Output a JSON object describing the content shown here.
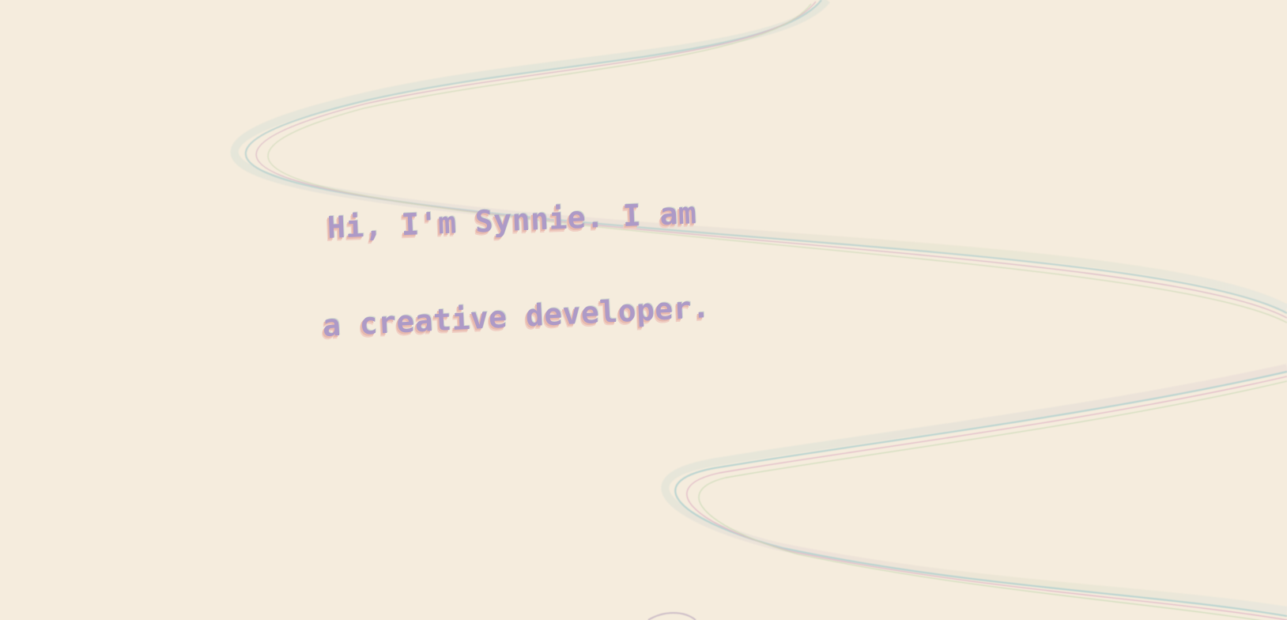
{
  "hero": {
    "line_1": "Hi, I'm Synnie. I am",
    "line_2": "a creative developer."
  },
  "colors": {
    "background": "#f5ecdd",
    "text": "#ad9ac7",
    "shadow_warm": "#e7b9ad",
    "ribbon_teal": "#a9c9c5",
    "ribbon_pink": "#e4b8c8",
    "ribbon_green": "#c9d7ad"
  }
}
